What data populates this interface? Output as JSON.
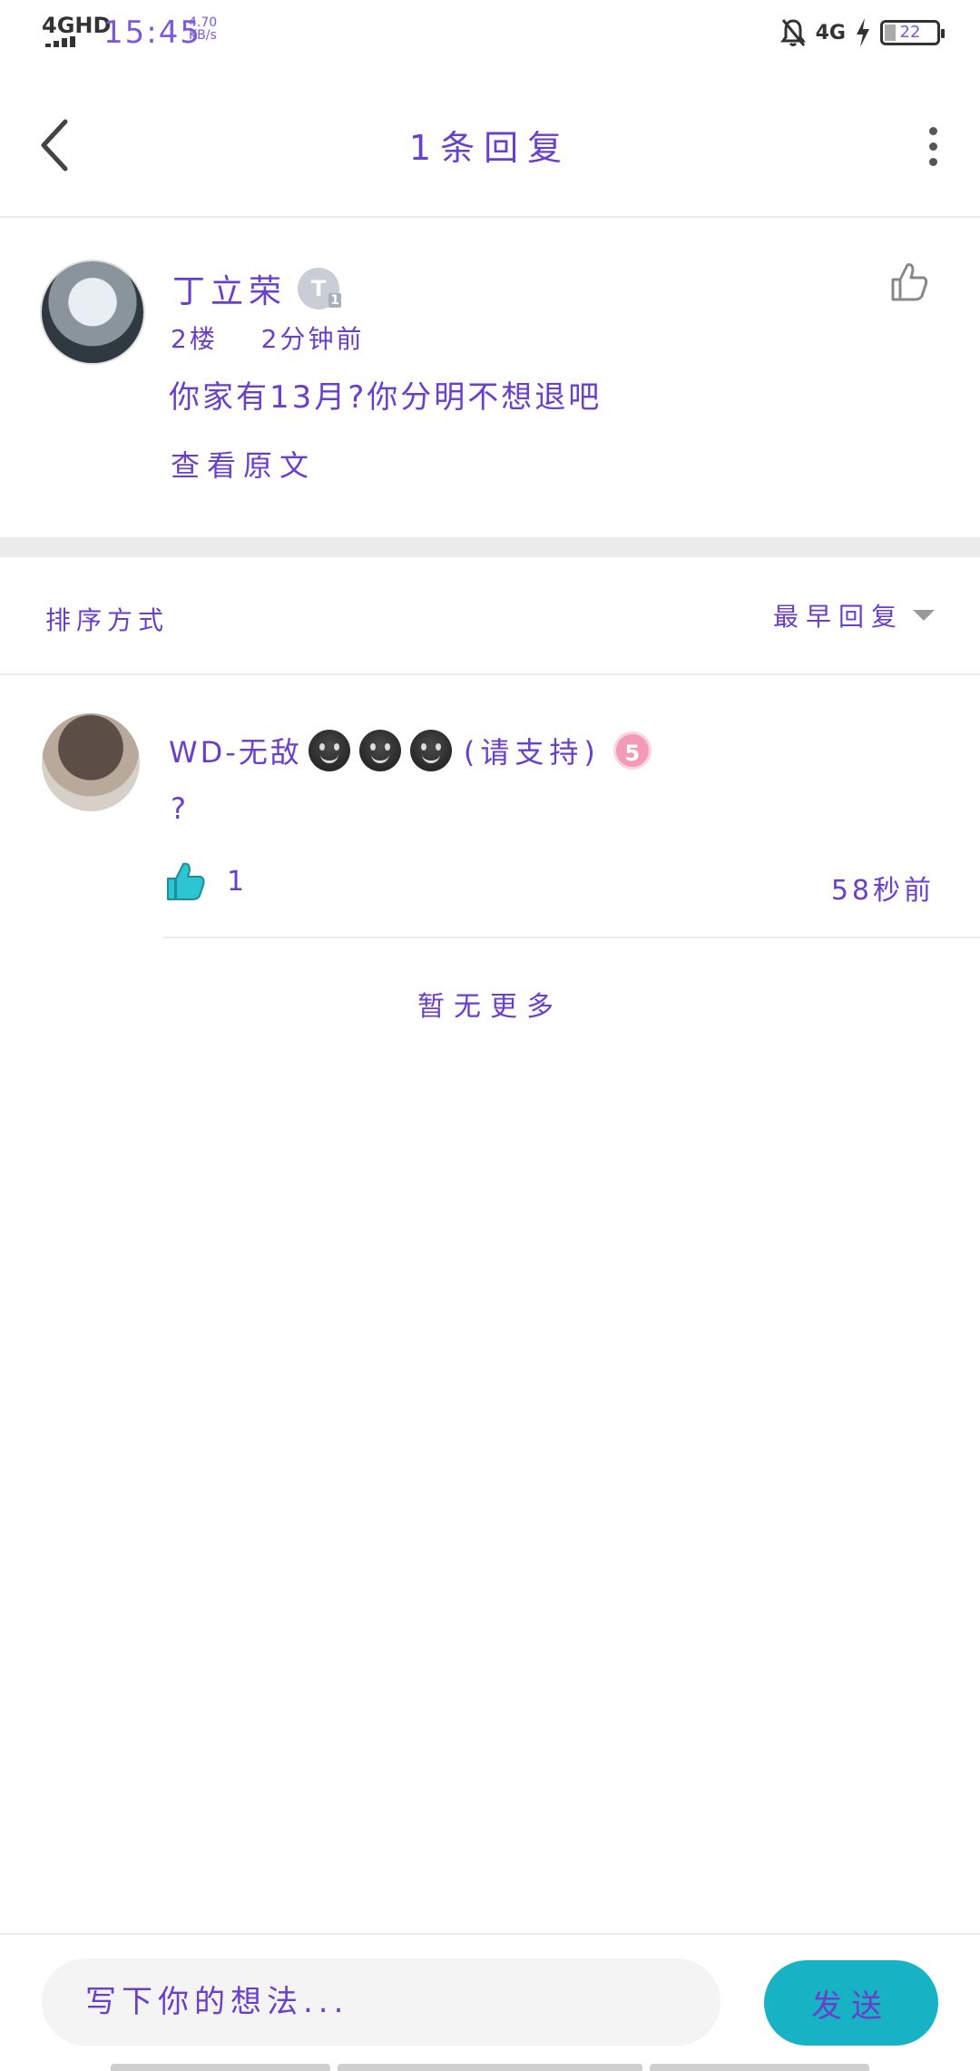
{
  "status_bar": {
    "network": "4GHD",
    "time": "15:45",
    "speed_value": "4.70",
    "speed_unit": "KB/s",
    "network_right": "4G",
    "battery": "22"
  },
  "header": {
    "title": "1条回复"
  },
  "post": {
    "author": "丁立荣",
    "level_badge": "T",
    "level_sub": "1",
    "floor": "2楼",
    "time": "2分钟前",
    "content": "你家有13月?你分明不想退吧",
    "view_original": "查看原文"
  },
  "sort": {
    "label": "排序方式",
    "value": "最早回复"
  },
  "reply": {
    "name": "WD-无敌",
    "name_tail": "(请支持)",
    "level": "5",
    "content": "?",
    "likes": "1",
    "time": "58秒前"
  },
  "footer": {
    "no_more": "暂无更多"
  },
  "input_bar": {
    "placeholder": "写下你的想法...",
    "send_label": "发送"
  },
  "colors": {
    "accent_text": "#6a3fc9",
    "send_button": "#17b3c5",
    "like_active": "#2ec5d3",
    "level_pink": "#f39ab7"
  }
}
